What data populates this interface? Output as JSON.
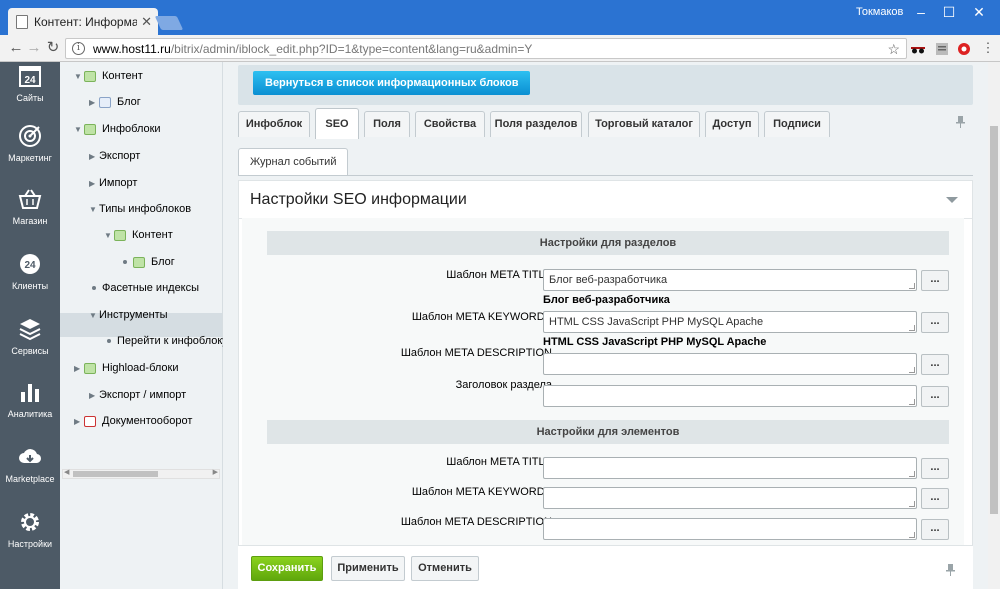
{
  "browser": {
    "tab_title": "Контент: Информационн",
    "user": "Токмаков",
    "url_host": "www.host11.ru",
    "url_path": "/bitrix/admin/iblock_edit.php?ID=1&type=content&lang=ru&admin=Y"
  },
  "leftbar": {
    "items": [
      {
        "label": "Сайты",
        "icon": "calendar-24-icon"
      },
      {
        "label": "Маркетинг",
        "icon": "target-icon"
      },
      {
        "label": "Магазин",
        "icon": "basket-icon"
      },
      {
        "label": "Клиенты",
        "icon": "clients-24-icon"
      },
      {
        "label": "Сервисы",
        "icon": "layers-icon"
      },
      {
        "label": "Аналитика",
        "icon": "bar-chart-icon"
      },
      {
        "label": "Marketplace",
        "icon": "cloud-download-icon"
      },
      {
        "label": "Настройки",
        "icon": "gear-icon"
      }
    ],
    "calendar_number": "24",
    "clients_number": "24"
  },
  "tree": {
    "items": [
      {
        "label": "Контент"
      },
      {
        "label": "Блог"
      },
      {
        "label": "Инфоблоки"
      },
      {
        "label": "Экспорт"
      },
      {
        "label": "Импорт"
      },
      {
        "label": "Типы инфоблоков"
      },
      {
        "label": "Контент"
      },
      {
        "label": "Блог"
      },
      {
        "label": "Фасетные индексы"
      },
      {
        "label": "Инструменты"
      },
      {
        "label": "Перейти к инфоблоку / э"
      },
      {
        "label": "Highload-блоки"
      },
      {
        "label": "Экспорт / импорт"
      },
      {
        "label": "Документооборот"
      }
    ]
  },
  "main": {
    "back_label": "Вернуться в список информационных блоков",
    "tabs": [
      {
        "label": "Инфоблок"
      },
      {
        "label": "SEO"
      },
      {
        "label": "Поля"
      },
      {
        "label": "Свойства"
      },
      {
        "label": "Поля разделов"
      },
      {
        "label": "Торговый каталог"
      },
      {
        "label": "Доступ"
      },
      {
        "label": "Подписи"
      }
    ],
    "subtab": "Журнал событий",
    "card_title": "Настройки SEO информации",
    "section_sections": "Настройки для разделов",
    "section_elements": "Настройки для элементов",
    "fields": [
      {
        "label": "Шаблон META TITLE",
        "value": "Блог веб-разработчика",
        "preview": "Блог веб-разработчика"
      },
      {
        "label": "Шаблон META KEYWORDS",
        "value": "HTML CSS JavaScript PHP MySQL Apache",
        "preview": "HTML CSS JavaScript PHP MySQL Apache"
      },
      {
        "label": "Шаблон META DESCRIPTION",
        "value": ""
      },
      {
        "label": "Заголовок раздела",
        "value": ""
      },
      {
        "label": "Шаблон META TITLE",
        "value": ""
      },
      {
        "label": "Шаблон META KEYWORDS",
        "value": ""
      },
      {
        "label": "Шаблон META DESCRIPTION",
        "value": ""
      }
    ],
    "dots_label": "..."
  },
  "footer": {
    "save": "Сохранить",
    "apply": "Применить",
    "cancel": "Отменить"
  },
  "colors": {
    "titlebar": "#2b73d2",
    "leftbar": "#4d5a66",
    "back_button": "#19a4e0",
    "save_button": "#6fb70f"
  }
}
